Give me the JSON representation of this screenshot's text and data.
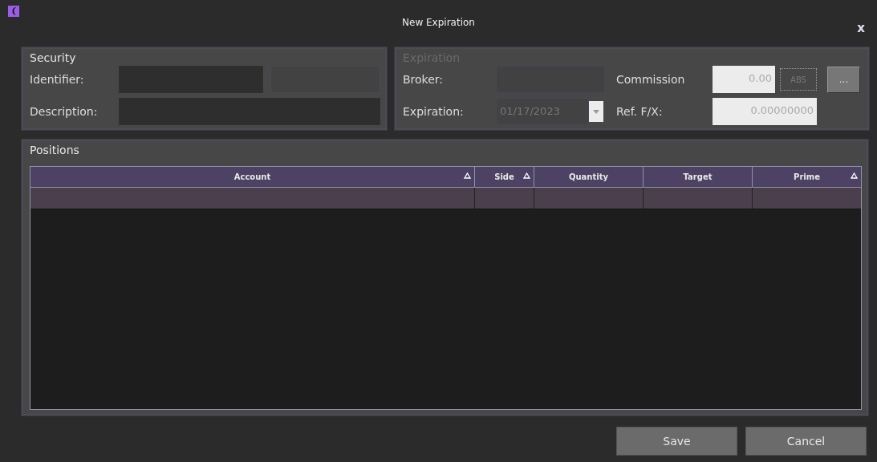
{
  "window": {
    "title": "New Expiration",
    "close": "x"
  },
  "security": {
    "label": "Security",
    "identifier_label": "Identifier:",
    "description_label": "Description:"
  },
  "expiration": {
    "label": "Expiration",
    "disabled": true,
    "broker_label": "Broker:",
    "expiration_label": "Expiration:",
    "expiration_value": "01/17/2023",
    "commission_label": "Commission",
    "commission_value": "0.00",
    "commission_type": "ABS",
    "ref_fx_label": "Ref. F/X:",
    "ref_fx_value": "0.00000000",
    "more_button": "..."
  },
  "positions": {
    "label": "Positions",
    "columns": [
      {
        "label": "Account",
        "sortable": true
      },
      {
        "label": "Side",
        "sortable": true
      },
      {
        "label": "Quantity",
        "sortable": false
      },
      {
        "label": "Target",
        "sortable": false
      },
      {
        "label": "Prime",
        "sortable": true
      }
    ]
  },
  "buttons": [
    {
      "label": "Save"
    },
    {
      "label": "Cancel"
    }
  ]
}
